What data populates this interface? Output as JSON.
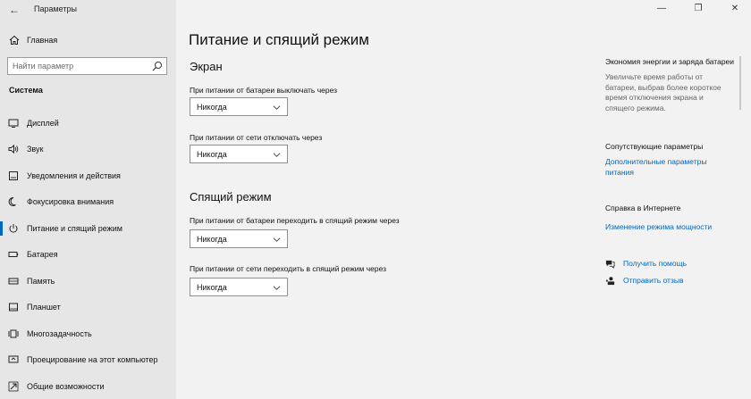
{
  "window": {
    "app_title": "Параметры",
    "back_icon": "back-arrow-icon",
    "controls": [
      "minimize-icon",
      "restore-icon",
      "close-icon"
    ]
  },
  "sidebar": {
    "home_label": "Главная",
    "search_placeholder": "Найти параметр",
    "section_header": "Система",
    "items": [
      {
        "label": "Дисплей",
        "icon": "display-icon",
        "active": false
      },
      {
        "label": "Звук",
        "icon": "speaker-icon",
        "active": false
      },
      {
        "label": "Уведомления и действия",
        "icon": "notifications-icon",
        "active": false
      },
      {
        "label": "Фокусировка внимания",
        "icon": "focus-assist-icon",
        "active": false
      },
      {
        "label": "Питание и спящий режим",
        "icon": "power-icon",
        "active": true
      },
      {
        "label": "Батарея",
        "icon": "battery-icon",
        "active": false
      },
      {
        "label": "Память",
        "icon": "storage-icon",
        "active": false
      },
      {
        "label": "Планшет",
        "icon": "tablet-icon",
        "active": false
      },
      {
        "label": "Многозадачность",
        "icon": "multitasking-icon",
        "active": false
      },
      {
        "label": "Проецирование на этот компьютер",
        "icon": "projecting-icon",
        "active": false
      },
      {
        "label": "Общие возможности",
        "icon": "shared-experiences-icon",
        "active": false
      }
    ]
  },
  "main": {
    "page_title": "Питание и спящий режим",
    "screen": {
      "title": "Экран",
      "battery_label": "При питании от батареи выключать через",
      "battery_value": "Никогда",
      "ac_label": "При питании от сети отключать через",
      "ac_value": "Никогда"
    },
    "sleep": {
      "title": "Спящий режим",
      "battery_label": "При питании от батареи переходить в спящий режим через",
      "battery_value": "Никогда",
      "ac_label": "При питании от сети переходить в спящий режим через",
      "ac_value": "Никогда"
    }
  },
  "right": {
    "saver_heading": "Экономия энергии и заряда батареи",
    "saver_text": "Увеличьте время работы от батареи, выбрав более короткое время отключения экрана и спящего режима.",
    "related_heading": "Сопутствующие параметры",
    "related_link": "Дополнительные параметры питания",
    "web_heading": "Справка в Интернете",
    "web_link": "Изменение режима мощности",
    "get_help": "Получить помощь",
    "feedback": "Отправить отзыв"
  },
  "colors": {
    "accent": "#0067c0",
    "sidebar_bg": "#e6e6e6",
    "content_bg": "#f2f2f2"
  }
}
